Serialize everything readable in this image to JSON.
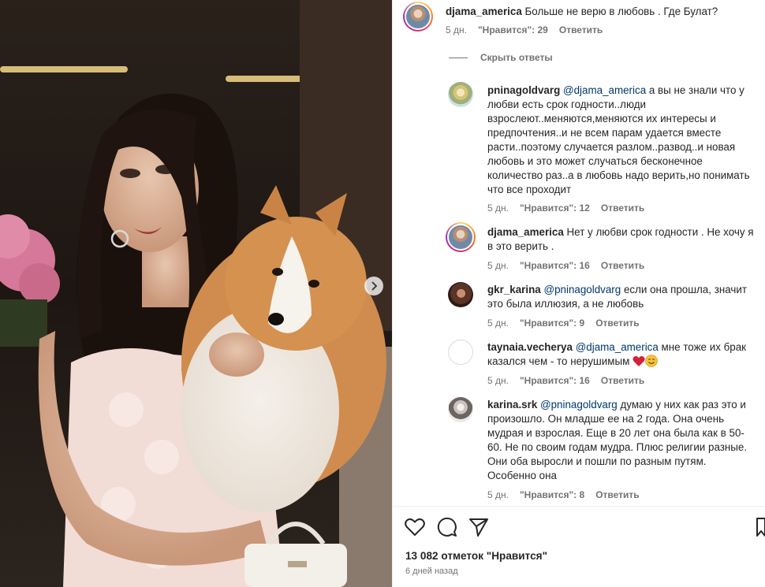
{
  "post": {
    "author": "djama_america",
    "caption": "Больше не верю в любовь . Где Булат?",
    "age": "5 дн.",
    "likes": "\"Нравится\": 29",
    "reply": "Ответить"
  },
  "hide_replies": "Скрыть ответы",
  "comments": [
    {
      "user": "pninagoldvarg",
      "mention": "@djama_america",
      "text": " а вы не знали что у любви есть срок годности..люди взрослеют..меняются,меняются их интересы и предпочтения..и не всем парам удается вместе расти..поэтому случается разлом..развод..и новая любовь и это может случаться бесконечное количество раз..а в любовь надо верить,но понимать что все проходит",
      "age": "5 дн.",
      "likes": "\"Нравится\": 12",
      "reply": "Ответить"
    },
    {
      "user": "djama_america",
      "mention": "",
      "text": "Нет у любви срок годности . Не хочу я в это верить .",
      "age": "5 дн.",
      "likes": "\"Нравится\": 16",
      "reply": "Ответить"
    },
    {
      "user": "gkr_karina",
      "mention": "@pninagoldvarg",
      "text": " если она прошла, значит это была иллюзия, а не любовь",
      "age": "5 дн.",
      "likes": "\"Нравится\": 9",
      "reply": "Ответить"
    },
    {
      "user": "taynaia.vecherya",
      "mention": "@djama_america",
      "text": " мне тоже их брак казался чем - то нерушимым ",
      "age": "5 дн.",
      "likes": "\"Нравится\": 16",
      "reply": "Ответить"
    },
    {
      "user": "karina.srk",
      "mention": "@pninagoldvarg",
      "text": " думаю у них как раз это и произошло. Он младше ее на 2 года. Она очень мудрая и взрослая. Еще в 20 лет она была как в 50-60. Не по своим годам мудра. Плюс религии разные. Они оба выросли и пошли по разным путям. Особенно она",
      "age": "5 дн.",
      "likes": "\"Нравится\": 8",
      "reply": "Ответить"
    }
  ],
  "footer": {
    "likes_total": "13 082 отметок \"Нравится\"",
    "date": "6 дней назад"
  },
  "icons": {
    "like": "heart-icon",
    "comment": "comment-icon",
    "share": "share-icon",
    "save": "bookmark-icon",
    "next": "chevron-right-icon"
  },
  "colors": {
    "mention": "#00376b",
    "meta": "#737373",
    "text": "#262626"
  }
}
